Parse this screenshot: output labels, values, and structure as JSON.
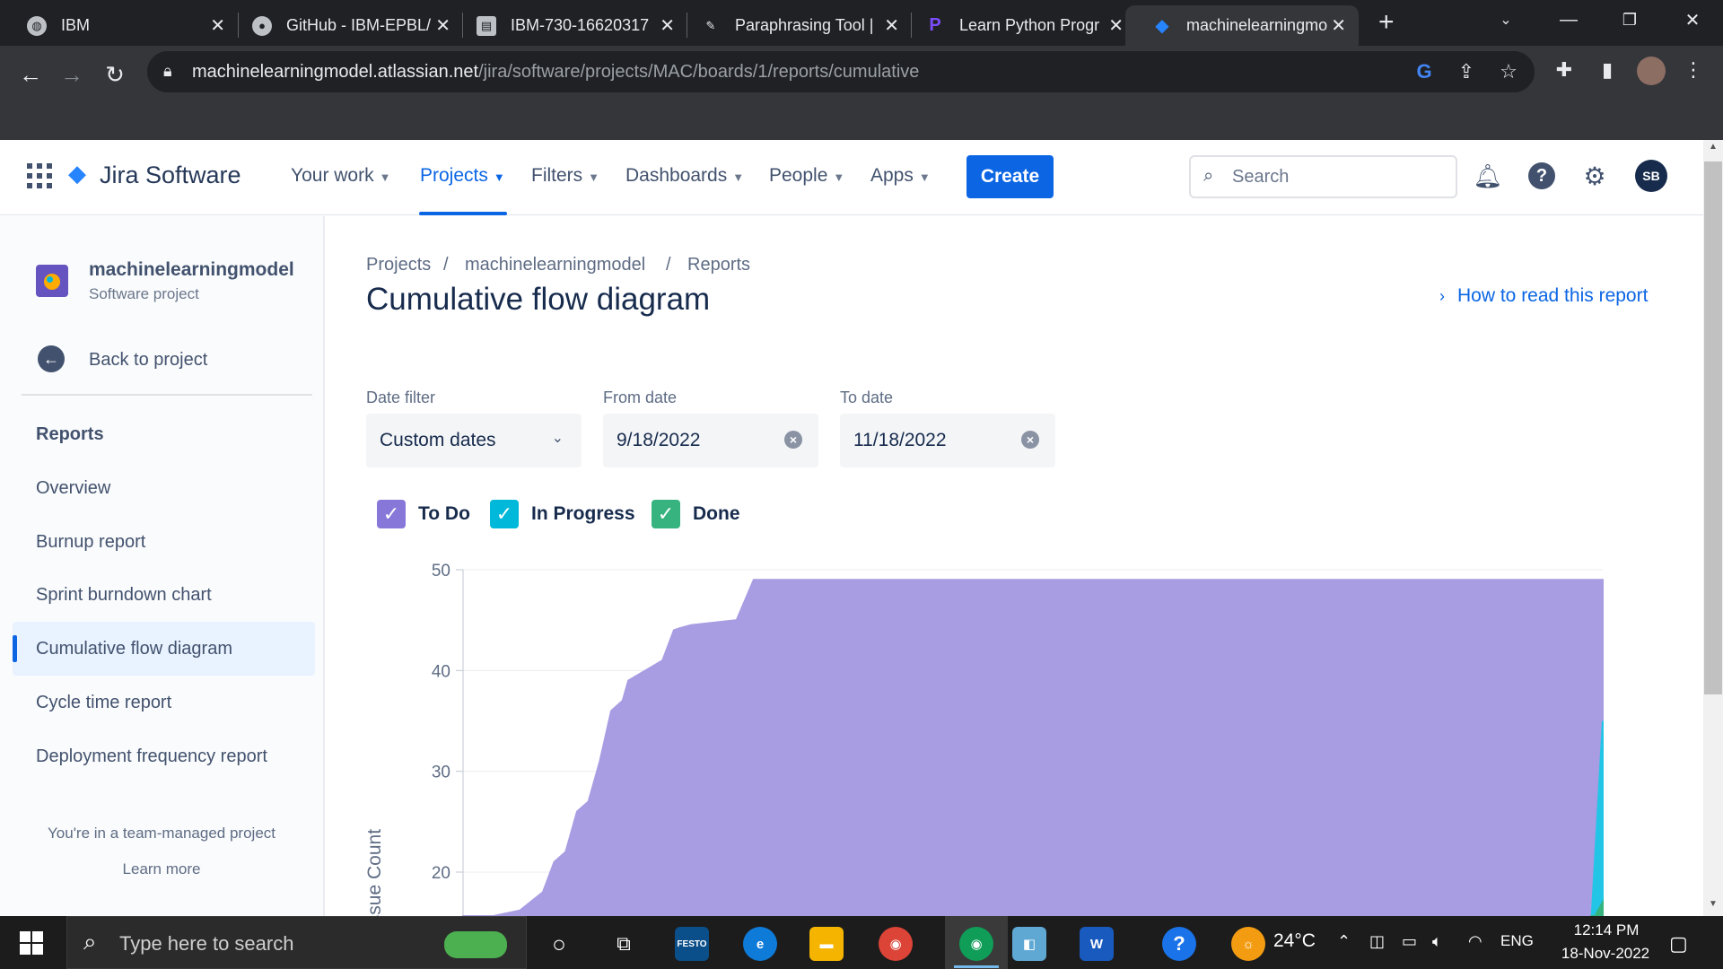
{
  "browser": {
    "tabs": [
      {
        "title": "IBM",
        "icon": "globe-icon"
      },
      {
        "title": "GitHub - IBM-EPBL/",
        "icon": "github-icon"
      },
      {
        "title": "IBM-730-16620317",
        "icon": "doc-icon"
      },
      {
        "title": "Paraphrasing Tool |",
        "icon": "quill-icon"
      },
      {
        "title": "Learn Python Progr",
        "icon": "python-icon"
      },
      {
        "title": "machinelearningmo",
        "icon": "jira-icon"
      }
    ],
    "url_host": "machinelearningmodel.atlassian.net",
    "url_path": "/jira/software/projects/MAC/boards/1/reports/cumulative"
  },
  "jira_nav": {
    "product": "Jira Software",
    "items": [
      "Your work",
      "Projects",
      "Filters",
      "Dashboards",
      "People",
      "Apps"
    ],
    "create_label": "Create",
    "search_placeholder": "Search",
    "avatar_initials": "SB"
  },
  "sidebar": {
    "project_name": "machinelearningmodel",
    "project_type": "Software project",
    "back_label": "Back to project",
    "section_title": "Reports",
    "items": [
      "Overview",
      "Burnup report",
      "Sprint burndown chart",
      "Cumulative flow diagram",
      "Cycle time report",
      "Deployment frequency report"
    ],
    "team_note": "You're in a team-managed project",
    "learn_more": "Learn more"
  },
  "main": {
    "breadcrumb": [
      "Projects",
      "machinelearningmodel",
      "Reports"
    ],
    "title": "Cumulative flow diagram",
    "help_link": "How to read this report",
    "date_filter_label": "Date filter",
    "date_filter_value": "Custom dates",
    "from_label": "From date",
    "from_value": "9/18/2022",
    "to_label": "To date",
    "to_value": "11/18/2022"
  },
  "chart_data": {
    "type": "area",
    "ylabel": "Issue Count",
    "ylim": [
      15,
      50
    ],
    "yticks": [
      50,
      40,
      30,
      20
    ],
    "series": [
      {
        "name": "To Do",
        "color": "#a89ce3",
        "x": [
          0,
          0.05,
          0.07,
          0.08,
          0.09,
          0.1,
          0.11,
          0.12,
          0.13,
          0.14,
          0.145,
          0.16,
          0.175,
          0.185,
          0.19,
          0.2,
          0.24,
          0.255,
          1.0
        ],
        "y": [
          15.0,
          16.2,
          18.0,
          21.0,
          22.0,
          26.0,
          27.0,
          31.0,
          36.0,
          37.0,
          39.0,
          40.0,
          41.0,
          44.0,
          44.2,
          44.5,
          45.0,
          49.0,
          49.0
        ]
      },
      {
        "name": "In Progress",
        "color": "#22c5e6",
        "x": [
          0.99,
          1.0
        ],
        "y": [
          15.0,
          35.0
        ]
      },
      {
        "name": "Done",
        "color": "#36b37e",
        "x": [
          0.99,
          1.0
        ],
        "y": [
          15.0,
          17.0
        ]
      }
    ]
  },
  "taskbar": {
    "search_placeholder": "Type here to search",
    "temperature": "24°C",
    "language": "ENG",
    "time": "12:14 PM",
    "date": "18-Nov-2022"
  }
}
